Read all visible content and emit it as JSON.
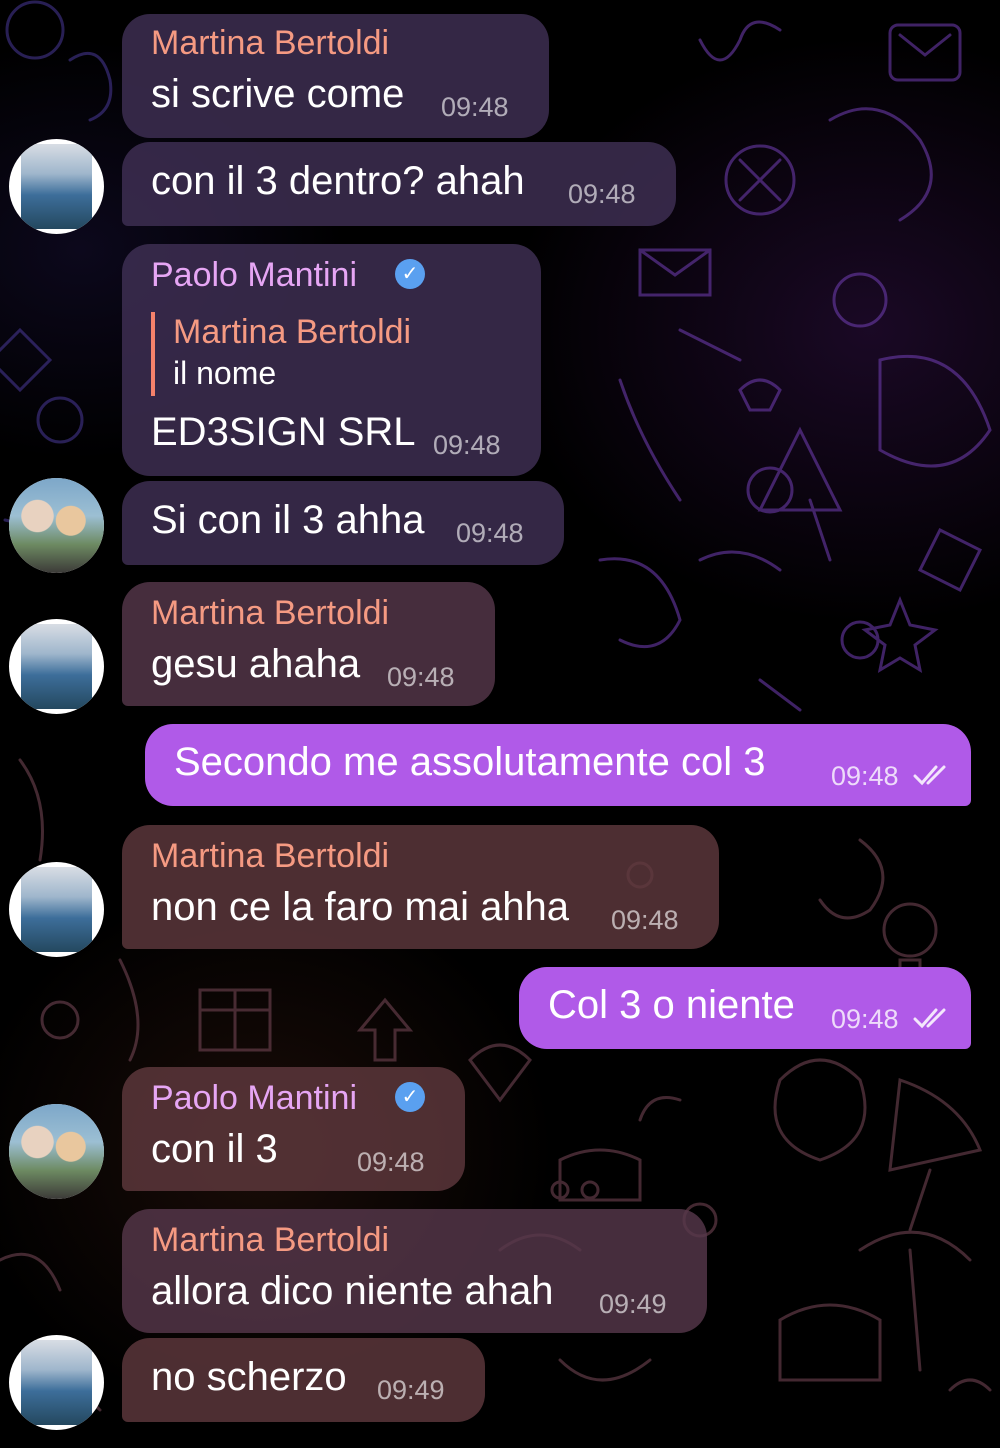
{
  "messages": [
    {
      "sender": "Martina Bertoldi",
      "text": "si scrive come",
      "time": "09:48"
    },
    {
      "text": "con il 3 dentro? ahah",
      "time": "09:48"
    },
    {
      "sender": "Paolo Mantini",
      "verified": true,
      "reply": {
        "sender": "Martina Bertoldi",
        "text": "il nome"
      },
      "text": "ED3SIGN SRL",
      "time": "09:48"
    },
    {
      "text": "Si con il 3 ahha",
      "time": "09:48"
    },
    {
      "sender": "Martina Bertoldi",
      "text": "gesu ahaha",
      "time": "09:48"
    },
    {
      "text": "Secondo me assolutamente col 3",
      "time": "09:48",
      "outgoing": true,
      "read": true
    },
    {
      "sender": "Martina Bertoldi",
      "text": "non ce la faro mai ahha",
      "time": "09:48"
    },
    {
      "text": "Col 3 o niente",
      "time": "09:48",
      "outgoing": true,
      "read": true
    },
    {
      "sender": "Paolo Mantini",
      "verified": true,
      "text": "con il 3",
      "time": "09:48"
    },
    {
      "sender": "Martina Bertoldi",
      "text": "allora dico niente ahah",
      "time": "09:49"
    },
    {
      "text": "no scherzo",
      "time": "09:49"
    }
  ],
  "colors": {
    "background": "#000000",
    "outgoing_bubble": "#b05ae8",
    "sender_martina": "#f59a82",
    "sender_paolo": "#e6a6f4",
    "verified_badge": "#5aa0f0",
    "reply_bar": "#f5826b"
  },
  "icons": {
    "verified": "verified-badge-icon",
    "read_receipt": "double-check-icon"
  }
}
